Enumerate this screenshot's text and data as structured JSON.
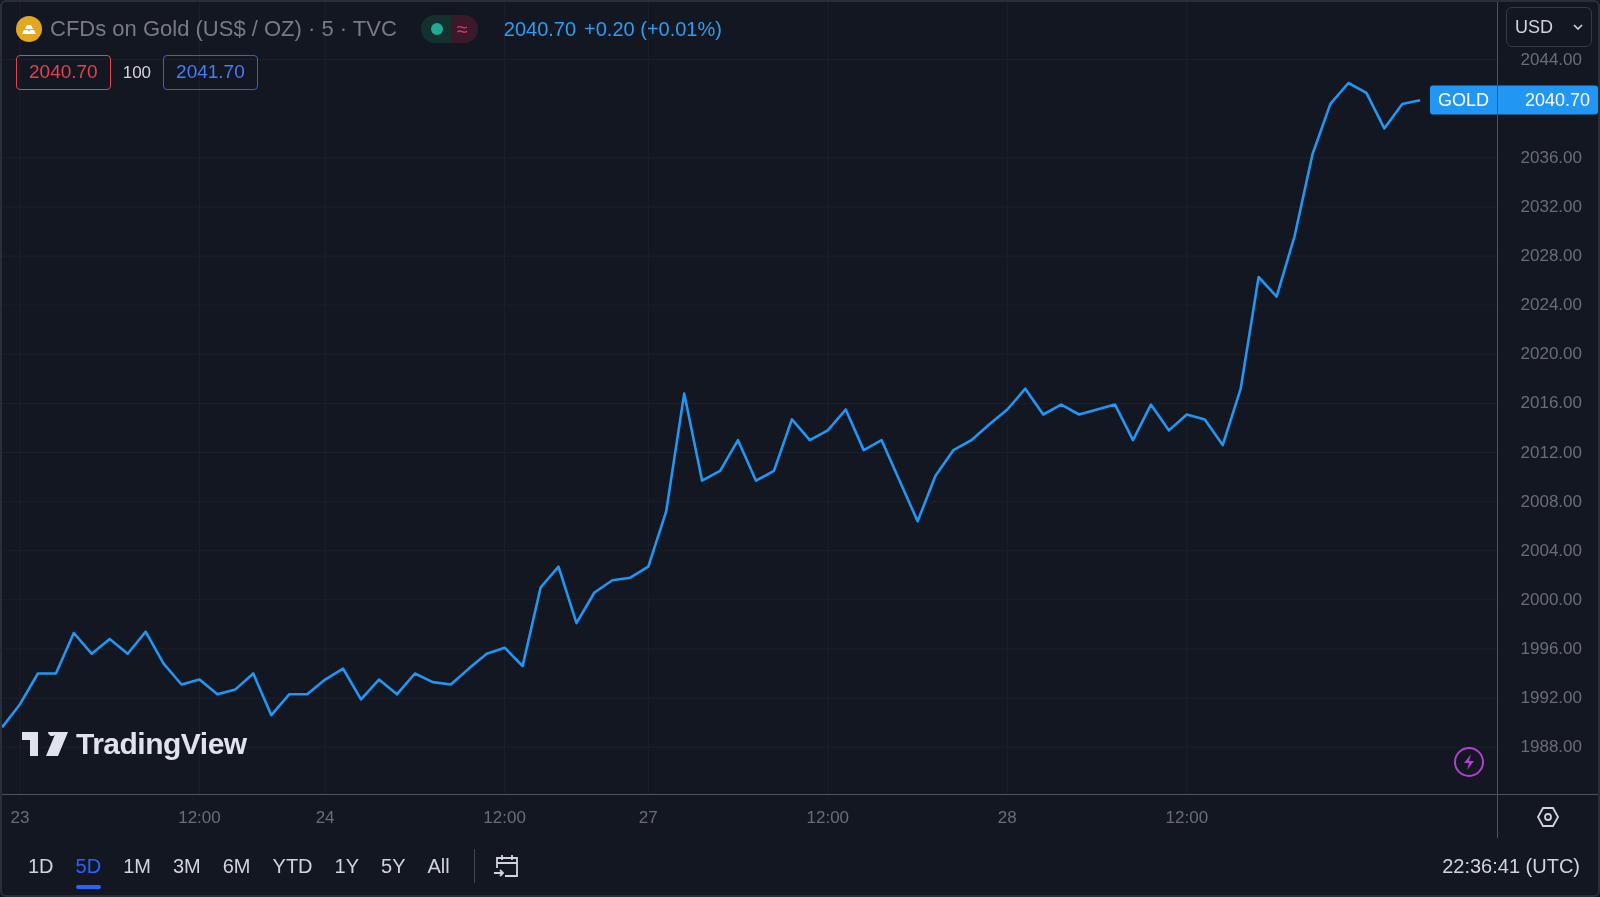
{
  "header": {
    "symbol": "CFDs on Gold (US$ / OZ) · 5 · TVC",
    "delay_mark": "≈",
    "last": "2040.70",
    "change": "+0.20 (+0.01%)"
  },
  "quote": {
    "bid": "2040.70",
    "size": "100",
    "ask": "2041.70"
  },
  "currency": "USD",
  "price_label": {
    "value": "2040.70"
  },
  "logo": "TradingView",
  "chart": {
    "chart_data": {
      "type": "line",
      "grid": true,
      "ylim": [
        1984.1,
        2048.7
      ],
      "categories": [
        null,
        "23",
        null,
        null,
        null,
        null,
        null,
        null,
        null,
        null,
        null,
        "12:00",
        null,
        null,
        null,
        null,
        null,
        null,
        "24",
        null,
        null,
        null,
        null,
        null,
        null,
        null,
        null,
        null,
        "12:00",
        null,
        null,
        null,
        null,
        null,
        null,
        null,
        "27",
        null,
        null,
        null,
        null,
        null,
        null,
        null,
        null,
        null,
        "12:00",
        null,
        null,
        null,
        null,
        null,
        null,
        null,
        null,
        null,
        "28",
        null,
        null,
        null,
        null,
        null,
        null,
        null,
        null,
        null,
        "12:00",
        null,
        null,
        null,
        null,
        null,
        null,
        null,
        null,
        null,
        null,
        null,
        null,
        null
      ],
      "yticks": [
        {
          "value": 1988,
          "label": "1988.00"
        },
        {
          "value": 1992,
          "label": "1992.00"
        },
        {
          "value": 1996,
          "label": "1996.00"
        },
        {
          "value": 2000,
          "label": "2000.00"
        },
        {
          "value": 2004,
          "label": "2004.00"
        },
        {
          "value": 2008,
          "label": "2008.00"
        },
        {
          "value": 2012,
          "label": "2012.00"
        },
        {
          "value": 2016,
          "label": "2016.00"
        },
        {
          "value": 2020,
          "label": "2020.00"
        },
        {
          "value": 2024,
          "label": "2024.00"
        },
        {
          "value": 2028,
          "label": "2028.00"
        },
        {
          "value": 2032,
          "label": "2032.00"
        },
        {
          "value": 2036,
          "label": "2036.00"
        },
        {
          "value": 2044,
          "label": "2044.00"
        }
      ],
      "series": [
        {
          "name": "GOLD",
          "color": "#2196f3",
          "values": [
            1989.6,
            1991.5,
            1994,
            1994,
            1997.3,
            1995.6,
            1996.8,
            1995.6,
            1997.4,
            1994.8,
            1993.1,
            1993.5,
            1992.3,
            1992.7,
            1994,
            1990.6,
            1992.3,
            1992.3,
            1993.5,
            1994.4,
            1991.9,
            1993.5,
            1992.3,
            1994,
            1993.3,
            1993.1,
            1994.4,
            1995.6,
            1996.1,
            1994.6,
            2001,
            2002.7,
            1998.1,
            2000.6,
            2001.6,
            2001.8,
            2002.7,
            2007.2,
            2016.8,
            2009.7,
            2010.5,
            2013,
            2009.7,
            2010.5,
            2014.7,
            2013,
            2013.8,
            2015.5,
            2012.2,
            2013,
            2009.7,
            2006.4,
            2010.1,
            2012.2,
            2013,
            2014.3,
            2015.5,
            2017.2,
            2015.1,
            2015.9,
            2015.1,
            2015.5,
            2015.9,
            2013,
            2015.9,
            2013.8,
            2015.1,
            2014.7,
            2012.6,
            2017.2,
            2026.3,
            2024.7,
            2029.6,
            2036.3,
            2040.4,
            2042.1,
            2041.3,
            2038.4,
            2040.4,
            2040.7
          ]
        }
      ]
    }
  },
  "ranges": [
    {
      "label": "1D",
      "selected": false
    },
    {
      "label": "5D",
      "selected": true
    },
    {
      "label": "1M",
      "selected": false
    },
    {
      "label": "3M",
      "selected": false
    },
    {
      "label": "6M",
      "selected": false
    },
    {
      "label": "YTD",
      "selected": false
    },
    {
      "label": "1Y",
      "selected": false
    },
    {
      "label": "5Y",
      "selected": false
    },
    {
      "label": "All",
      "selected": false
    }
  ],
  "clock": "22:36:41 (UTC)"
}
